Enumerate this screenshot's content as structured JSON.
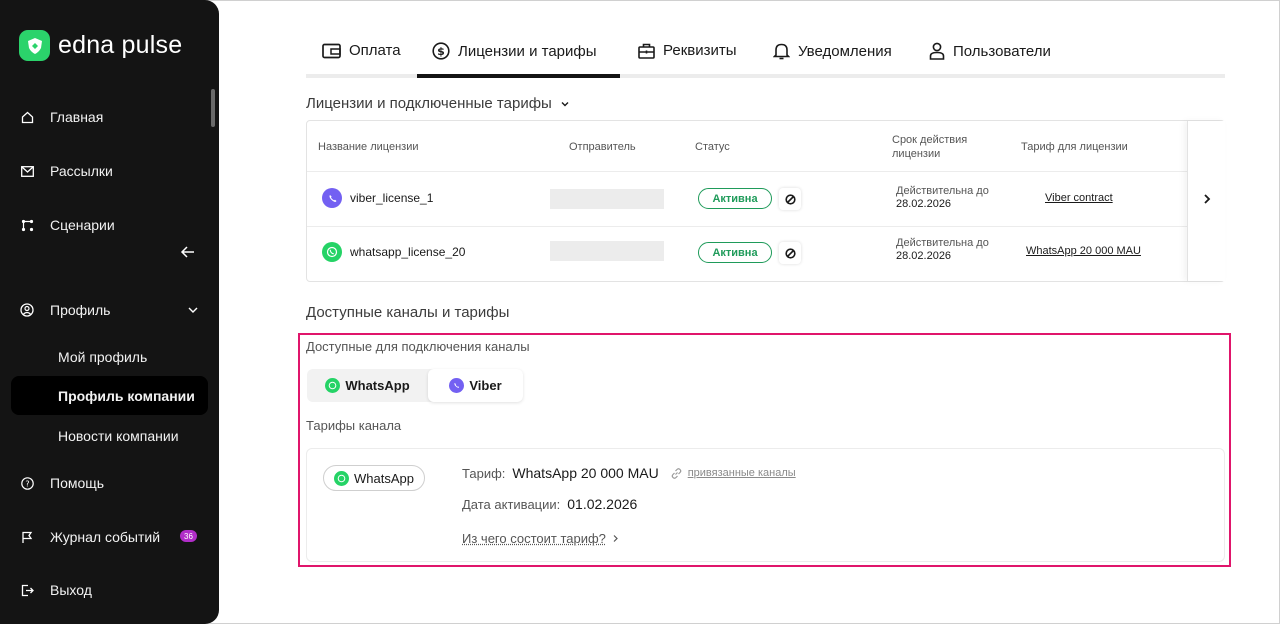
{
  "brand": {
    "name": "edna pulse",
    "accent": "#2bd36b"
  },
  "sidebar": {
    "items": [
      {
        "label": "Главная",
        "icon": "home-icon"
      },
      {
        "label": "Рассылки",
        "icon": "mail-icon"
      },
      {
        "label": "Сценарии",
        "icon": "scenario-icon"
      },
      {
        "label": "Профиль",
        "icon": "user-circle-icon"
      },
      {
        "label": "Помощь",
        "icon": "help-icon"
      },
      {
        "label": "Журнал событий",
        "icon": "flag-icon",
        "badge": "36"
      },
      {
        "label": "Выход",
        "icon": "logout-icon"
      }
    ],
    "profile_sub": [
      "Мой профиль",
      "Профиль компании",
      "Новости компании"
    ],
    "active_sub": "Профиль компании"
  },
  "tabs": [
    {
      "label": "Оплата",
      "icon": "card-icon"
    },
    {
      "label": "Лицензии и тарифы",
      "icon": "dollar-icon",
      "active": true
    },
    {
      "label": "Реквизиты",
      "icon": "briefcase-icon"
    },
    {
      "label": "Уведомления",
      "icon": "bell-icon"
    },
    {
      "label": "Пользователи",
      "icon": "user-icon"
    }
  ],
  "licenses": {
    "title": "Лицензии и подключенные тарифы",
    "columns": [
      "Название лицензии",
      "Отправитель",
      "Статус",
      "Срок действия лицензии",
      "Тариф для лицензии"
    ],
    "rows": [
      {
        "name": "viber_license_1",
        "channel": "viber",
        "status": "Активна",
        "valid_label": "Действительна до",
        "valid_date": "28.02.2026",
        "tariff": "Viber contract"
      },
      {
        "name": "whatsapp_license_20",
        "channel": "whatsapp",
        "status": "Активна",
        "valid_label": "Действительна до",
        "valid_date": "28.02.2026",
        "tariff": "WhatsApp 20 000 MAU"
      }
    ]
  },
  "available": {
    "title": "Доступные каналы и тарифы",
    "channels_label": "Доступные для подключения каналы",
    "channels": [
      "WhatsApp",
      "Viber"
    ],
    "selected_channel": "WhatsApp",
    "tariffs_label": "Тарифы канала",
    "card": {
      "chip": "WhatsApp",
      "tariff_key": "Тариф:",
      "tariff_value": "WhatsApp 20 000 MAU",
      "linked": "привязанные каналы",
      "date_key": "Дата активации:",
      "date_value": "01.02.2026",
      "what": "Из чего состоит тариф?"
    }
  },
  "colors": {
    "viber": "#7360f2",
    "whatsapp": "#25d366",
    "status_green": "#1f9b5a",
    "highlight": "#e0156b"
  }
}
